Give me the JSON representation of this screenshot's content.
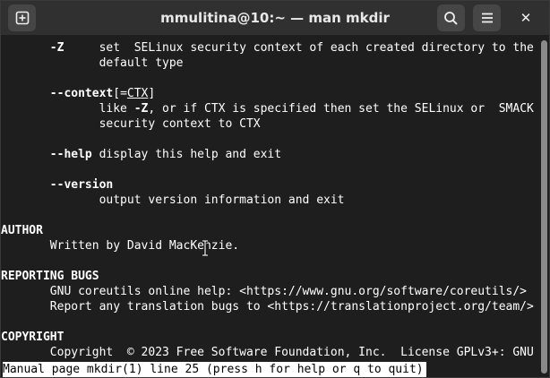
{
  "window": {
    "title": "mmulitina@10:~ — man mkdir"
  },
  "icons": {
    "new_tab": "new-tab-icon",
    "search": "search-icon",
    "menu": "hamburger-menu-icon",
    "close": "close-icon"
  },
  "close_glyph": "✕",
  "man": {
    "z_flag": "-Z",
    "z_desc1": "set  SELinux security context of each created directory to the",
    "z_desc2": "default type",
    "context_flag": "--context",
    "context_open": "[=",
    "context_ctx": "CTX",
    "context_close": "]",
    "context_desc1_a": "like ",
    "context_desc1_z": "-Z",
    "context_desc1_b": ", or if CTX is specified then set the SELinux or  SMACK",
    "context_desc2": "security context to CTX",
    "help_flag": "--help",
    "help_desc": " display this help and exit",
    "version_flag": "--version",
    "version_desc": "output version information and exit",
    "author_heading": "AUTHOR",
    "author_text": "Written by David MacKenzie.",
    "bugs_heading": "REPORTING BUGS",
    "bugs_line1": "GNU coreutils online help: <https://www.gnu.org/software/coreutils/>",
    "bugs_line2": "Report any translation bugs to <https://translationproject.org/team/>",
    "copyright_heading": "COPYRIGHT",
    "copyright_text": "Copyright  © 2023 Free Software Foundation, Inc.  License GPLv3+: GNU"
  },
  "status": {
    "text": "Manual page mkdir(1) line 25 (press h for help or q to quit)"
  }
}
